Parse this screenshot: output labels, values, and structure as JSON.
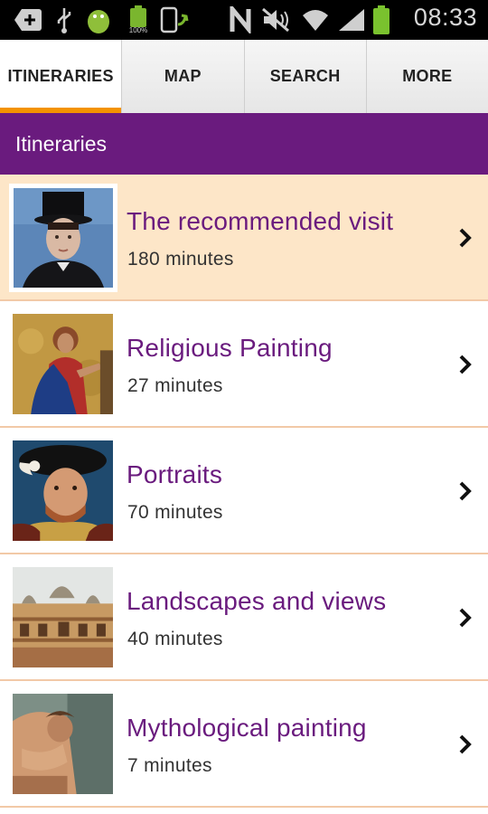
{
  "status_bar": {
    "time": "08:33",
    "battery_label": "100%",
    "icons": [
      "add-icon",
      "usb-icon",
      "android-debug-icon",
      "battery-full-icon",
      "phone-sync-icon",
      "nfc-icon",
      "mute-icon",
      "wifi-icon",
      "signal-icon",
      "battery-icon"
    ]
  },
  "tabs": [
    {
      "label": "ITINERARIES",
      "active": true
    },
    {
      "label": "MAP",
      "active": false
    },
    {
      "label": "SEARCH",
      "active": false
    },
    {
      "label": "MORE",
      "active": false
    }
  ],
  "header": {
    "title": "Itineraries"
  },
  "colors": {
    "accent": "#6a1b7e",
    "tab_indicator": "#f39200",
    "selected_row": "#fde6c8",
    "divider": "#f2c9a7"
  },
  "itineraries": [
    {
      "title": "The recommended visit",
      "duration": "180 minutes",
      "selected": true
    },
    {
      "title": "Religious Painting",
      "duration": "27 minutes",
      "selected": false
    },
    {
      "title": "Portraits",
      "duration": "70 minutes",
      "selected": false
    },
    {
      "title": "Landscapes and views",
      "duration": "40 minutes",
      "selected": false
    },
    {
      "title": "Mythological painting",
      "duration": "7 minutes",
      "selected": false
    }
  ]
}
